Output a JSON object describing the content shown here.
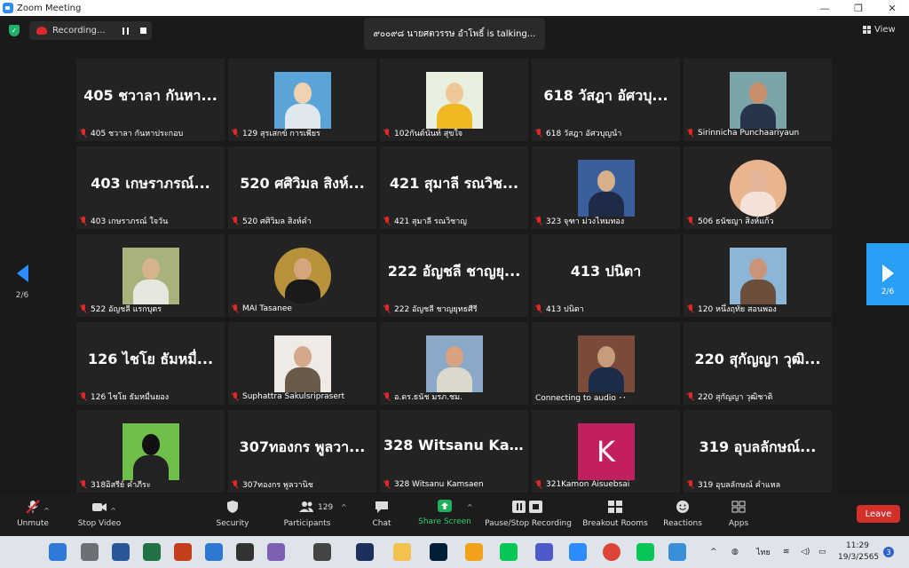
{
  "window": {
    "title": "Zoom Meeting",
    "controls": {
      "minimize": "—",
      "maximize": "❐",
      "close": "✕"
    }
  },
  "meeting_bar": {
    "recording_label": "Recording...",
    "talking": "๙๐๐๙๘ นายศตวรรษ อำโพธิ์ is talking...",
    "view_label": "View"
  },
  "pagination": {
    "left": "2/6",
    "right": "2/6"
  },
  "tiles": [
    {
      "big": "405 ชวาลา กันหา...",
      "label": "405 ชวาลา กันหาประกอบ"
    },
    {
      "photo": "suit-blue",
      "label": "129 สุรเสกข์ การเพียร"
    },
    {
      "photo": "smile-yellow",
      "label": "102กันต์นันท์ สุขใจ"
    },
    {
      "big": "618 วัสฎา อัศวบุ...",
      "label": "618 วัสฎา อัศวบุญนำ"
    },
    {
      "photo": "portrait-woman",
      "label": "Sirinnicha Punchaariyaun"
    },
    {
      "big": "403 เกษราภรณ์...",
      "label": "403 เกษราภรณ์ ใจวัน"
    },
    {
      "big": "520 ศศิวิมล  สิงห์...",
      "label": "520 ศศิวิมล  สิงห์คำ"
    },
    {
      "big": "421 สุมาลี รณวิช...",
      "label": "421 สุมาลี รณวิชาญ"
    },
    {
      "photo": "suit-navy",
      "label": "323 จุฑา ม่วงไหมทอง"
    },
    {
      "photo": "round-girl",
      "label": "506 ธนัชญา สิงห์แก้ว"
    },
    {
      "photo": "outdoor-cap",
      "label": "522 อัญชลี แรกบุตร"
    },
    {
      "photo": "gold-frame",
      "label": "MAI Tasanee"
    },
    {
      "big": "222 อัญชลี ชาญยุ...",
      "label": "222 อัญชลี ชาญยุทธศีรี"
    },
    {
      "big": "413 ปนิตา",
      "label": "413 ปนิตา"
    },
    {
      "photo": "beach-girl",
      "label": "120 หนึ่งฤทัย สอนพอง"
    },
    {
      "big": "126 ไชโย ธัมหมื่...",
      "label": "126 ไชโย ธัมหมื่นยอง"
    },
    {
      "photo": "woman-cat",
      "label": "Suphattra Sakulsriprasert"
    },
    {
      "photo": "uniform-man",
      "label": "อ.ดร.ธนัช มรภ.ชม."
    },
    {
      "photo": "standing-girl",
      "label": "Connecting to audio ･･",
      "unmuted": true
    },
    {
      "big": "220 สุกัญญา วุฒิ...",
      "label": "220 สุกัญญา วุฒิชาติ"
    },
    {
      "photo": "cartoon-eye",
      "label": "318อิสรีย์ คำภีระ"
    },
    {
      "big": "307ทองกร พูลวา...",
      "label": "307ทองกร พูลวานิช"
    },
    {
      "big": "328 Witsanu Ka...",
      "label": "328 Witsanu Kamsaen"
    },
    {
      "letter": "K",
      "label": "321Kamon Aisuebsai"
    },
    {
      "big": "319 อุบลลักษณ์...",
      "label": "319 อุบลลักษณ์ คำแหล"
    }
  ],
  "toolbar": {
    "unmute": "Unmute",
    "stop_video": "Stop Video",
    "security": "Security",
    "participants": "Participants",
    "participants_count": "129",
    "chat": "Chat",
    "share_screen": "Share Screen",
    "pause_stop_recording": "Pause/Stop Recording",
    "breakout_rooms": "Breakout Rooms",
    "reactions": "Reactions",
    "apps": "Apps",
    "leave": "Leave"
  },
  "taskbar": {
    "lang": "ไทย",
    "time": "11:29",
    "date": "19/3/2565",
    "notifications": "3"
  },
  "colors": {
    "accent": "#2d8cff",
    "share_green": "#1fb15a",
    "leave_red": "#d3302c",
    "muted_red": "#e02828",
    "tile_bg": "#232323"
  }
}
